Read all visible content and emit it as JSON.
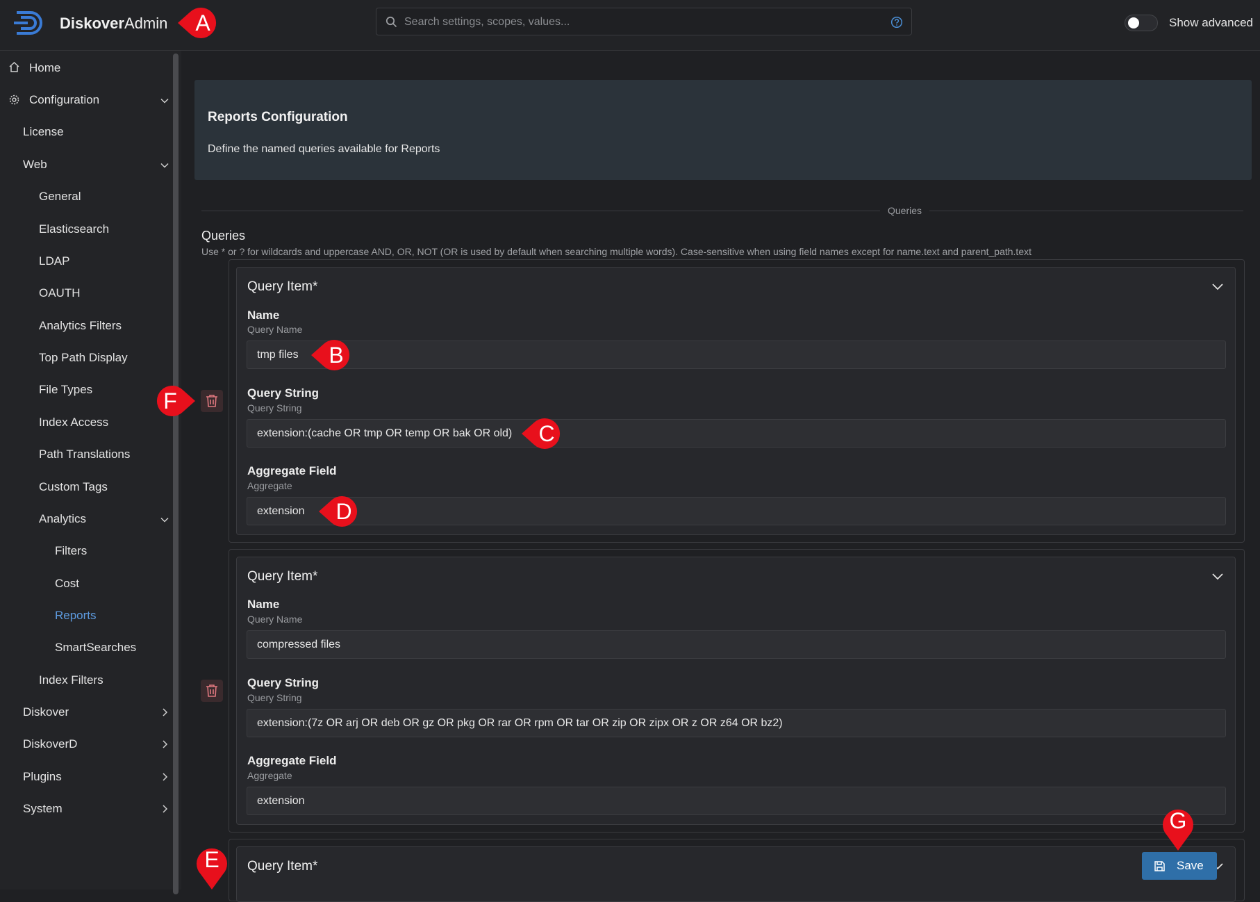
{
  "app": {
    "brand_bold": "Diskover",
    "brand_rest": "Admin"
  },
  "search": {
    "placeholder": "Search settings, scopes, values..."
  },
  "show_advanced": {
    "label": "Show advanced",
    "enabled": false
  },
  "sidebar": {
    "items": [
      {
        "label": "Home"
      },
      {
        "label": "Configuration"
      },
      {
        "label": "License"
      },
      {
        "label": "Web"
      },
      {
        "label": "General"
      },
      {
        "label": "Elasticsearch"
      },
      {
        "label": "LDAP"
      },
      {
        "label": "OAUTH"
      },
      {
        "label": "Analytics Filters"
      },
      {
        "label": "Top Path Display"
      },
      {
        "label": "File Types"
      },
      {
        "label": "Index Access"
      },
      {
        "label": "Path Translations"
      },
      {
        "label": "Custom Tags"
      },
      {
        "label": "Analytics"
      },
      {
        "label": "Filters"
      },
      {
        "label": "Cost"
      },
      {
        "label": "Reports",
        "active": true
      },
      {
        "label": "SmartSearches"
      },
      {
        "label": "Index Filters"
      },
      {
        "label": "Diskover"
      },
      {
        "label": "DiskoverD"
      },
      {
        "label": "Plugins"
      },
      {
        "label": "System"
      }
    ]
  },
  "header": {
    "title": "Reports Configuration",
    "description": "Define the named queries available for Reports"
  },
  "divider": {
    "label": "Queries"
  },
  "section": {
    "title": "Queries",
    "help": "Use * or ? for wildcards and uppercase AND, OR, NOT (OR is used by default when searching multiple words). Case-sensitive when using field names except for name.text and parent_path.text"
  },
  "query_items": [
    {
      "title": "Query Item*",
      "name_label": "Name",
      "name_sub": "Query Name",
      "name_value": "tmp files",
      "qs_label": "Query String",
      "qs_sub": "Query String",
      "qs_value": "extension:(cache OR tmp OR temp OR bak OR old)",
      "agg_label": "Aggregate Field",
      "agg_sub": "Aggregate",
      "agg_value": "extension"
    },
    {
      "title": "Query Item*",
      "name_label": "Name",
      "name_sub": "Query Name",
      "name_value": "compressed files",
      "qs_label": "Query String",
      "qs_sub": "Query String",
      "qs_value": "extension:(7z OR arj OR deb OR gz OR pkg OR rar OR rpm OR tar OR zip OR zipx OR z OR z64 OR bz2)",
      "agg_label": "Aggregate Field",
      "agg_sub": "Aggregate",
      "agg_value": "extension"
    },
    {
      "title": "Query Item*"
    }
  ],
  "save_button": {
    "label": "Save"
  },
  "markers": {
    "a": "A",
    "b": "B",
    "c": "C",
    "d": "D",
    "e": "E",
    "f": "F",
    "g": "G"
  },
  "colors": {
    "marker": "#e8101c",
    "accent": "#2f6fa8",
    "active_link": "#5d9be0"
  }
}
